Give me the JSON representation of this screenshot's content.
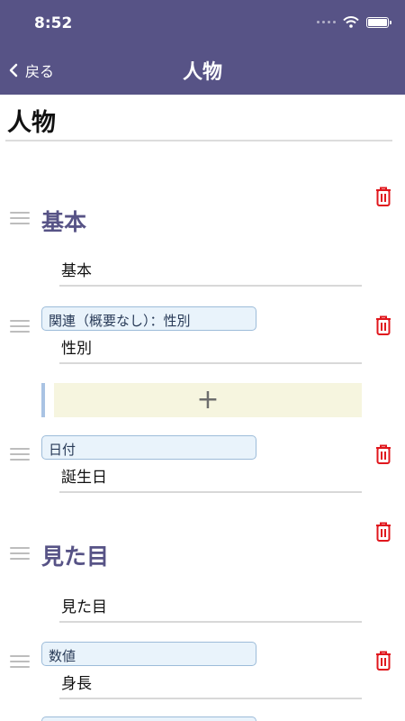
{
  "status_bar": {
    "time": "8:52"
  },
  "nav": {
    "back_label": "戻る",
    "title": "人物"
  },
  "page": {
    "title": "人物"
  },
  "sections": [
    {
      "title": "基本",
      "name_value": "基本"
    },
    {
      "title": "見た目",
      "name_value": "見た目"
    }
  ],
  "items": [
    {
      "type_label": "関連（概要なし）：性別",
      "value": "性別"
    },
    {
      "type_label": "日付",
      "value": "誕生日"
    },
    {
      "type_label": "数値",
      "value": "身長"
    }
  ],
  "add_button": {
    "label": "+"
  },
  "colors": {
    "header": "#575386",
    "trash": "#e0171d",
    "section_title": "#575386",
    "tag_bg": "#e9f3fb",
    "add_bg": "#f6f5df"
  }
}
